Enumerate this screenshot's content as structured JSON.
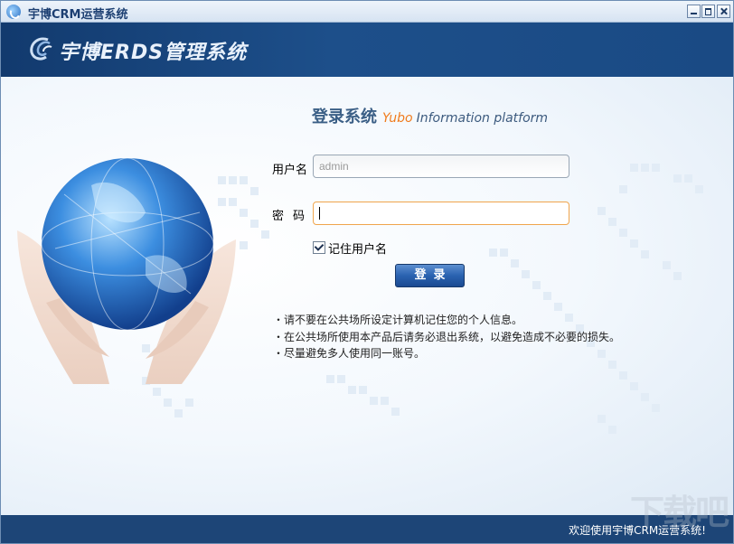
{
  "window": {
    "title": "宇博CRM运营系统",
    "controls": [
      "minimize",
      "maximize",
      "close"
    ]
  },
  "banner": {
    "logo_text": "宇博ERDS管理系统",
    "logo_icon": "swirl-logo-icon"
  },
  "login": {
    "title_cn": "登录系统",
    "title_yubo": "Yubo",
    "title_en": "Information platform",
    "username_label": "用户名",
    "username_value": "admin",
    "password_label": "密码",
    "password_value": "",
    "remember_label": "记住用户名",
    "remember_checked": true,
    "submit_label": "登录"
  },
  "notes": [
    "・请不要在公共场所设定计算机记住您的个人信息。",
    "・在公共场所使用本产品后请务必退出系统，以避免造成不必要的损失。",
    "・尽量避免多人使用同一账号。"
  ],
  "status": {
    "welcome": "欢迎使用宇博CRM运营系统!",
    "watermark": "下载吧"
  },
  "colors": {
    "banner": "#1d4f8a",
    "statusbar": "#1d4577",
    "accent_orange": "#f07c1e",
    "title_blue": "#3b5f86"
  }
}
